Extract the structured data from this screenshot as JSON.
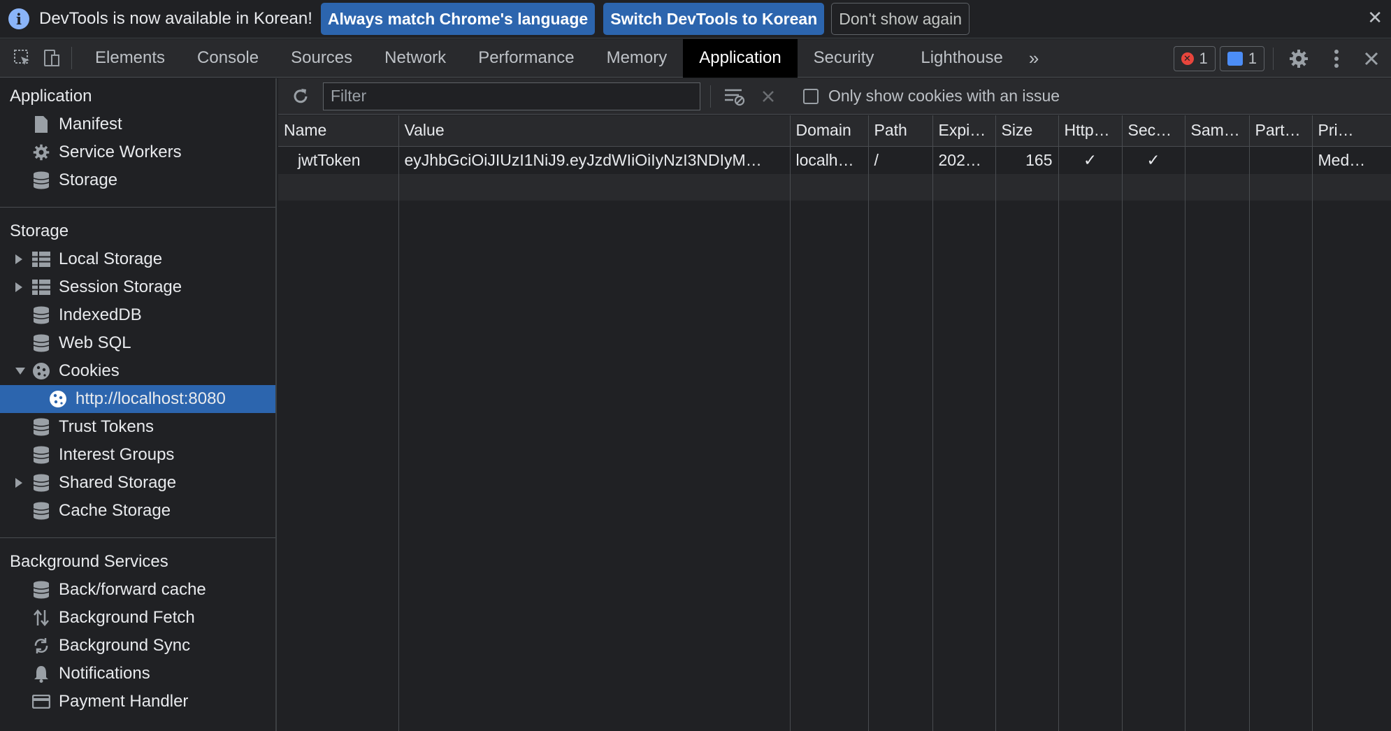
{
  "infobar": {
    "message": "DevTools is now available in Korean!",
    "btn_match": "Always match Chrome's language",
    "btn_switch": "Switch DevTools to Korean",
    "btn_dismiss": "Don't show again",
    "close": "✕"
  },
  "tabs": [
    "Elements",
    "Console",
    "Sources",
    "Network",
    "Performance",
    "Memory",
    "Application",
    "Security",
    "Lighthouse"
  ],
  "active_tab": "Application",
  "more_tabs": "»",
  "badges": {
    "errors": "1",
    "messages": "1"
  },
  "sidebar": {
    "application": {
      "title": "Application",
      "items": [
        "Manifest",
        "Service Workers",
        "Storage"
      ]
    },
    "storage": {
      "title": "Storage",
      "items": [
        "Local Storage",
        "Session Storage",
        "IndexedDB",
        "Web SQL",
        "Cookies",
        "http://localhost:8080",
        "Trust Tokens",
        "Interest Groups",
        "Shared Storage",
        "Cache Storage"
      ]
    },
    "background": {
      "title": "Background Services",
      "items": [
        "Back/forward cache",
        "Background Fetch",
        "Background Sync",
        "Notifications",
        "Payment Handler"
      ]
    }
  },
  "cookie_toolbar": {
    "filter_placeholder": "Filter",
    "only_issue_label": "Only show cookies with an issue"
  },
  "table": {
    "columns": [
      "Name",
      "Value",
      "Domain",
      "Path",
      "Expi…",
      "Size",
      "Http…",
      "Sec…",
      "Sam…",
      "Part…",
      "Pri…"
    ],
    "rows": [
      [
        "jwtToken",
        "eyJhbGciOiJIUzI1NiJ9.eyJzdWIiOiIyNzI3NDIyM…",
        "localh…",
        "/",
        "202…",
        "165",
        "✓",
        "✓",
        "",
        "",
        "Med…"
      ]
    ]
  }
}
